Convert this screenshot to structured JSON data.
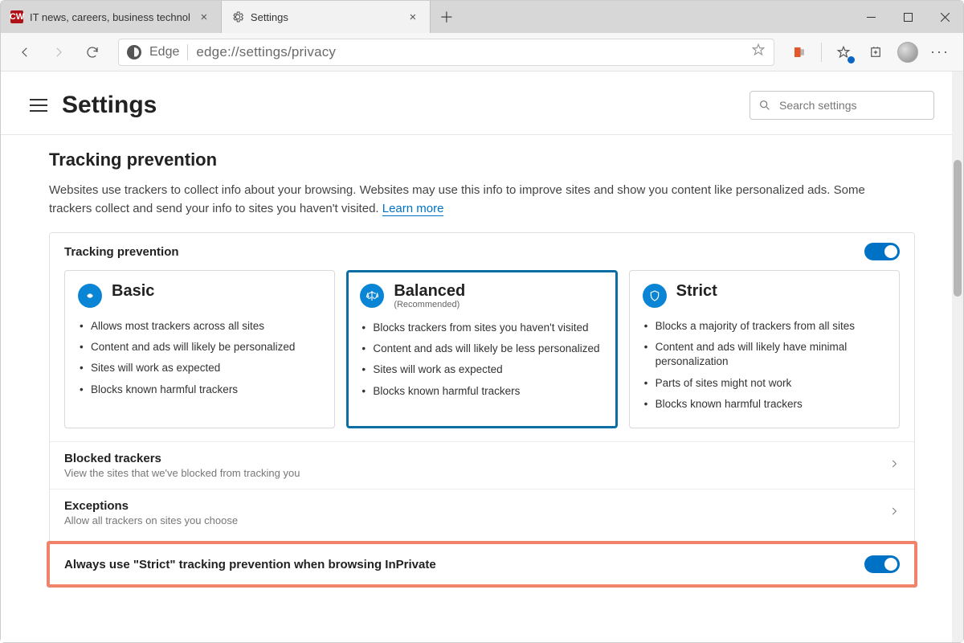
{
  "window": {
    "tabs": [
      {
        "favicon_text": "CW",
        "favicon_bg": "#b01116",
        "favicon_fg": "#ffffff",
        "title": "IT news, careers, business technol"
      },
      {
        "favicon_text": "",
        "title": "Settings"
      }
    ],
    "address": {
      "site_label": "Edge",
      "url": "edge://settings/privacy"
    }
  },
  "header": {
    "title": "Settings",
    "search_placeholder": "Search settings"
  },
  "section": {
    "title": "Tracking prevention",
    "description": "Websites use trackers to collect info about your browsing. Websites may use this info to improve sites and show you content like personalized ads. Some trackers collect and send your info to sites you haven't visited.",
    "learn_more": "Learn more"
  },
  "panel": {
    "label": "Tracking prevention",
    "toggle_on": true,
    "cards": [
      {
        "id": "basic",
        "title": "Basic",
        "subtitle": "",
        "selected": false,
        "bullets": [
          "Allows most trackers across all sites",
          "Content and ads will likely be personalized",
          "Sites will work as expected",
          "Blocks known harmful trackers"
        ]
      },
      {
        "id": "balanced",
        "title": "Balanced",
        "subtitle": "(Recommended)",
        "selected": true,
        "bullets": [
          "Blocks trackers from sites you haven't visited",
          "Content and ads will likely be less personalized",
          "Sites will work as expected",
          "Blocks known harmful trackers"
        ]
      },
      {
        "id": "strict",
        "title": "Strict",
        "subtitle": "",
        "selected": false,
        "bullets": [
          "Blocks a majority of trackers from all sites",
          "Content and ads will likely have minimal personalization",
          "Parts of sites might not work",
          "Blocks known harmful trackers"
        ]
      }
    ],
    "rows": [
      {
        "title": "Blocked trackers",
        "subtitle": "View the sites that we've blocked from tracking you"
      },
      {
        "title": "Exceptions",
        "subtitle": "Allow all trackers on sites you choose"
      }
    ],
    "inprivate": {
      "label": "Always use \"Strict\" tracking prevention when browsing InPrivate",
      "toggle_on": true
    }
  }
}
